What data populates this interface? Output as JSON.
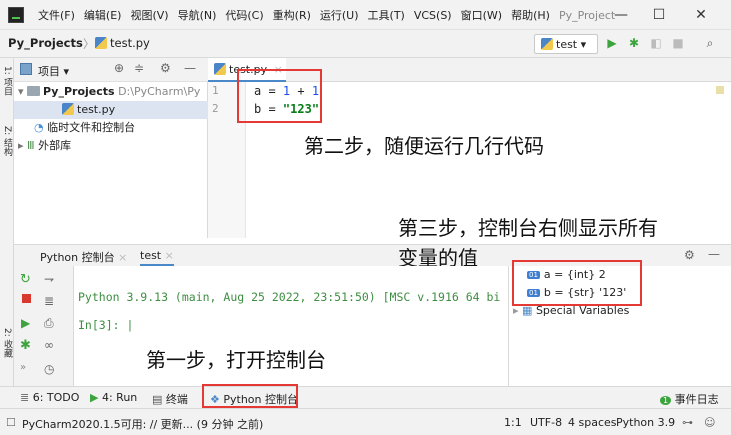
{
  "menu": {
    "items": [
      "文件(F)",
      "编辑(E)",
      "视图(V)",
      "导航(N)",
      "代码(C)",
      "重构(R)",
      "运行(U)",
      "工具(T)",
      "VCS(S)",
      "窗口(W)",
      "帮助(H)"
    ],
    "project_name": "Py_Project"
  },
  "window_controls": {
    "minimize": "—",
    "maximize": "☐",
    "close": "✕"
  },
  "navbar": {
    "root": "Py_Projects",
    "file": "test.py",
    "run_config": "test ▾"
  },
  "left_stripe": {
    "project_label": "1: 项目",
    "structure_label": "Z: 结构",
    "favorites_label": "2: 收藏"
  },
  "project_panel": {
    "header_label": "项目 ▾",
    "tree": [
      {
        "label": "Py_Projects",
        "path": "D:\\PyCharm\\Py"
      },
      {
        "label": "test.py"
      },
      {
        "label": "临时文件和控制台"
      },
      {
        "label": "外部库"
      }
    ]
  },
  "editor": {
    "tab_label": "test.py",
    "line_numbers": [
      "1",
      "2"
    ],
    "code": [
      {
        "var": "a",
        "op": " = ",
        "val1": "1",
        "plus": " + ",
        "val2": "1"
      },
      {
        "var": "b",
        "op": " = ",
        "str": "\"123\""
      }
    ]
  },
  "annotations": {
    "step2": "第二步，随便运行几行代码",
    "step3_line1": "第三步，控制台右侧显示所有",
    "step3_line2": "变量的值",
    "step1": "第一步，打开控制台"
  },
  "console": {
    "tabs": [
      "Python 控制台",
      "test"
    ],
    "banner": "Python 3.9.13 (main, Aug 25 2022, 23:51:50) [MSC v.1916 64 bi",
    "prompt": "In[3]: |"
  },
  "variables": {
    "items": [
      {
        "badge": "01",
        "text": "a = {int} 2"
      },
      {
        "badge": "01",
        "text": "b = {str} '123'"
      }
    ],
    "special": "Special Variables"
  },
  "bottom_tabs": {
    "todo": "6: TODO",
    "run": "4: Run",
    "terminal": "终端",
    "python_console": "Python 控制台",
    "event_log": "事件日志"
  },
  "status": {
    "message": "PyCharm2020.1.5可用: // 更新... (9 分钟 之前)",
    "position": "1:1",
    "encoding": "UTF-8",
    "indent": "4 spaces",
    "interpreter": "Python 3.9"
  }
}
